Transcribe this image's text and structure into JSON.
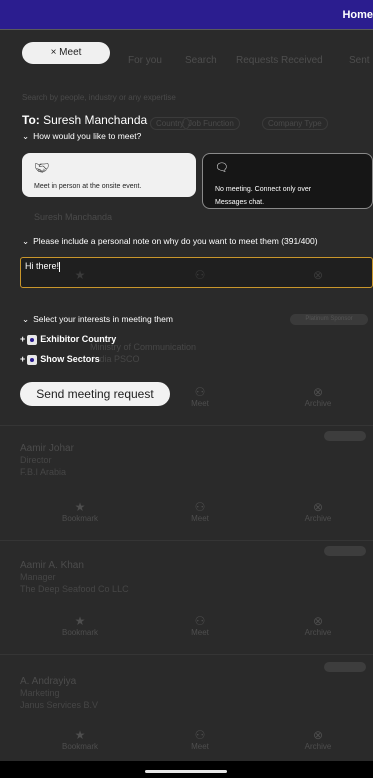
{
  "header": {
    "home_label": "Home"
  },
  "background": {
    "tabs": [
      "For you",
      "Search",
      "Requests Received",
      "Sent"
    ],
    "search_hint": "Search by people, industry or any expertise",
    "filters": [
      "Country",
      "Job Function",
      "Company Type"
    ],
    "ghost_name": "Suresh Manchanda",
    "ghost_badge": "Platinum Sponsor",
    "ghost_company_line": "Ministry of Communication",
    "ghost_company_line2": "India PSCO",
    "actions": {
      "bookmark": "Bookmark",
      "meet": "Meet",
      "archive": "Archive"
    },
    "cards": [
      {
        "name": "Aamir Johar",
        "role": "Director",
        "company": "F.B.I Arabia"
      },
      {
        "name": "Aamir A. Khan",
        "role": "Manager",
        "company": "The Deep Seafood Co LLC"
      },
      {
        "name": "A. Andrayiya",
        "role": "Marketing",
        "company": "Janus Services B.V"
      }
    ]
  },
  "modal": {
    "chip_label": "× Meet",
    "to_prefix": "To:",
    "to_name": "Suresh Manchanda",
    "q_how": "How would you like to meet?",
    "option_in_person": "Meet in person at the onsite event.",
    "option_messages_line1": "No meeting. Connect only over",
    "option_messages_line2": "Messages chat.",
    "note_prompt": "Please include a personal note on why do you want to meet them (391/400)",
    "note_value": "Hi there!",
    "interests_prompt": "Select your interests in meeting them",
    "interest_items": [
      "Exhibitor Country",
      "Show Sectors"
    ],
    "send_label": "Send meeting request"
  },
  "colors": {
    "header_bg": "#2b1d8f",
    "input_border": "#c9962b",
    "overlay_bg": "#2a2a2a"
  }
}
